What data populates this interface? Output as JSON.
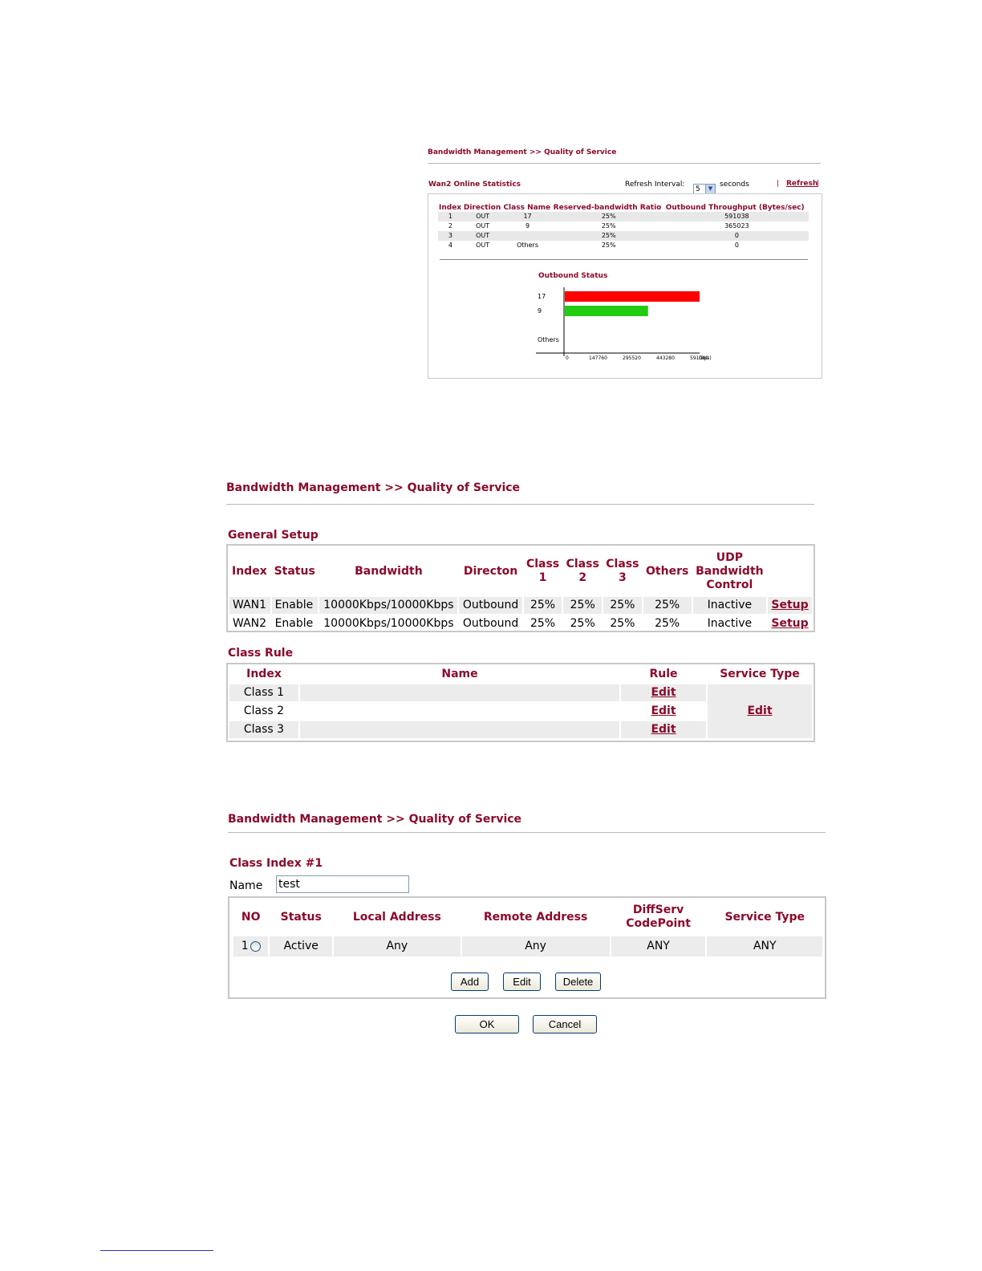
{
  "screen1": {
    "breadcrumb": "Bandwidth Management >> Quality of Service",
    "section_title": "Wan2 Online Statistics",
    "refresh_label": "Refresh Interval:",
    "refresh_value": "5",
    "refresh_unit": "seconds",
    "refresh_link": "Refresh",
    "table_headers": [
      "Index",
      "Direction",
      "Class Name",
      "Reserved-bandwidth Ratio",
      "Outbound Throughput (Bytes/sec)"
    ],
    "rows": [
      [
        "1",
        "OUT",
        "17",
        "25%",
        "591038"
      ],
      [
        "2",
        "OUT",
        "9",
        "25%",
        "365023"
      ],
      [
        "3",
        "OUT",
        "",
        "25%",
        "0"
      ],
      [
        "4",
        "OUT",
        "Others",
        "25%",
        "0"
      ]
    ],
    "chart_data": {
      "type": "bar",
      "orientation": "horizontal",
      "title": "Outbound Status",
      "categories": [
        "17",
        "9",
        "",
        "Others"
      ],
      "values": [
        591038,
        365023,
        0,
        0
      ],
      "colors": [
        "#ff0000",
        "#22cc11",
        "#22cc11",
        "#22cc11"
      ],
      "xticks": [
        "0",
        "147760",
        "295520",
        "443280",
        "591040"
      ],
      "xunit": "(Bps)",
      "xlim": [
        0,
        591040
      ]
    }
  },
  "screen2": {
    "breadcrumb": "Bandwidth Management >> Quality of Service",
    "general_title": "General Setup",
    "general_headers": [
      "Index",
      "Status",
      "Bandwidth",
      "Directon",
      "Class\n1",
      "Class\n2",
      "Class\n3",
      "Others",
      "UDP\nBandwidth\nControl",
      ""
    ],
    "general_rows": [
      {
        "index": "WAN1",
        "status": "Enable",
        "bandwidth": "10000Kbps/10000Kbps",
        "direction": "Outbound",
        "c1": "25%",
        "c2": "25%",
        "c3": "25%",
        "others": "25%",
        "udp": "Inactive",
        "action": "Setup"
      },
      {
        "index": "WAN2",
        "status": "Enable",
        "bandwidth": "10000Kbps/10000Kbps",
        "direction": "Outbound",
        "c1": "25%",
        "c2": "25%",
        "c3": "25%",
        "others": "25%",
        "udp": "Inactive",
        "action": "Setup"
      }
    ],
    "class_rule_title": "Class Rule",
    "class_headers": [
      "Index",
      "Name",
      "Rule",
      "Service Type"
    ],
    "class_rows": [
      {
        "index": "Class 1",
        "name": "",
        "rule": "Edit"
      },
      {
        "index": "Class 2",
        "name": "",
        "rule": "Edit"
      },
      {
        "index": "Class 3",
        "name": "",
        "rule": "Edit"
      }
    ],
    "service_type_link": "Edit"
  },
  "screen3": {
    "breadcrumb": "Bandwidth Management >> Quality of Service",
    "class_index_title": "Class Index #1",
    "name_label": "Name",
    "name_value": "test",
    "headers": [
      "NO",
      "Status",
      "Local Address",
      "Remote Address",
      "DiffServ\nCodePoint",
      "Service Type"
    ],
    "rows": [
      {
        "no": "1",
        "status": "Active",
        "local": "Any",
        "remote": "Any",
        "diffserv": "ANY",
        "service": "ANY"
      }
    ],
    "buttons": {
      "add": "Add",
      "edit": "Edit",
      "delete": "Delete",
      "ok": "OK",
      "cancel": "Cancel"
    }
  }
}
